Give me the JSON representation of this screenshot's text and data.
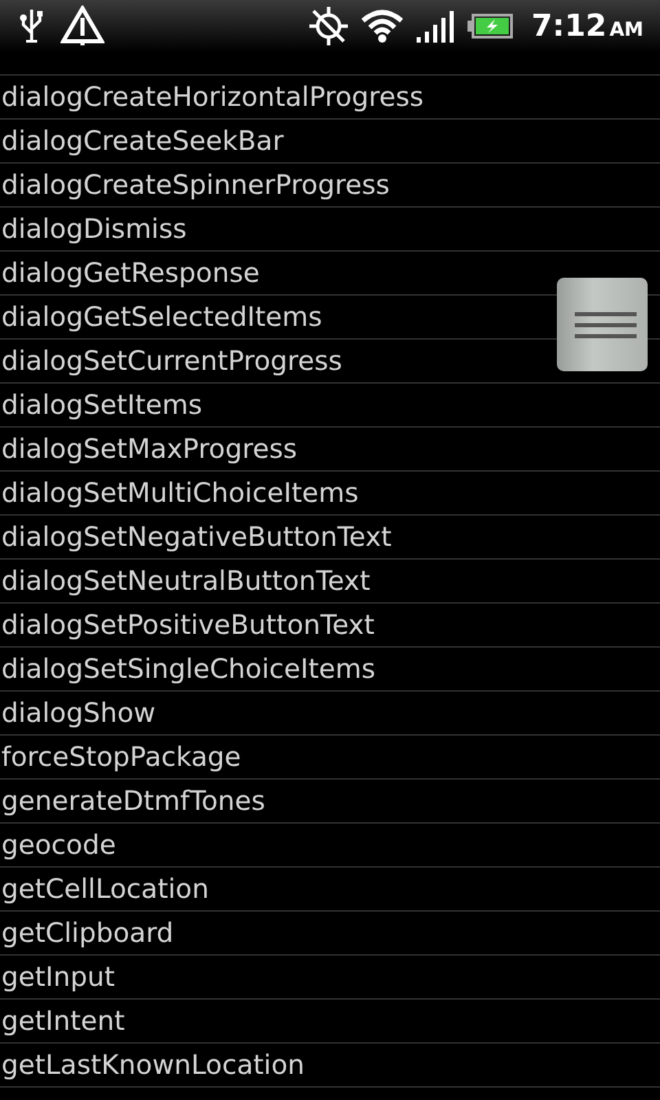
{
  "status_bar": {
    "time": "7:12",
    "ampm": "AM"
  },
  "items": [
    "dialogCreateHorizontalProgress",
    "dialogCreateSeekBar",
    "dialogCreateSpinnerProgress",
    "dialogDismiss",
    "dialogGetResponse",
    "dialogGetSelectedItems",
    "dialogSetCurrentProgress",
    "dialogSetItems",
    "dialogSetMaxProgress",
    "dialogSetMultiChoiceItems",
    "dialogSetNegativeButtonText",
    "dialogSetNeutralButtonText",
    "dialogSetPositiveButtonText",
    "dialogSetSingleChoiceItems",
    "dialogShow",
    "forceStopPackage",
    "generateDtmfTones",
    "geocode",
    "getCellLocation",
    "getClipboard",
    "getInput",
    "getIntent",
    "getLastKnownLocation"
  ]
}
